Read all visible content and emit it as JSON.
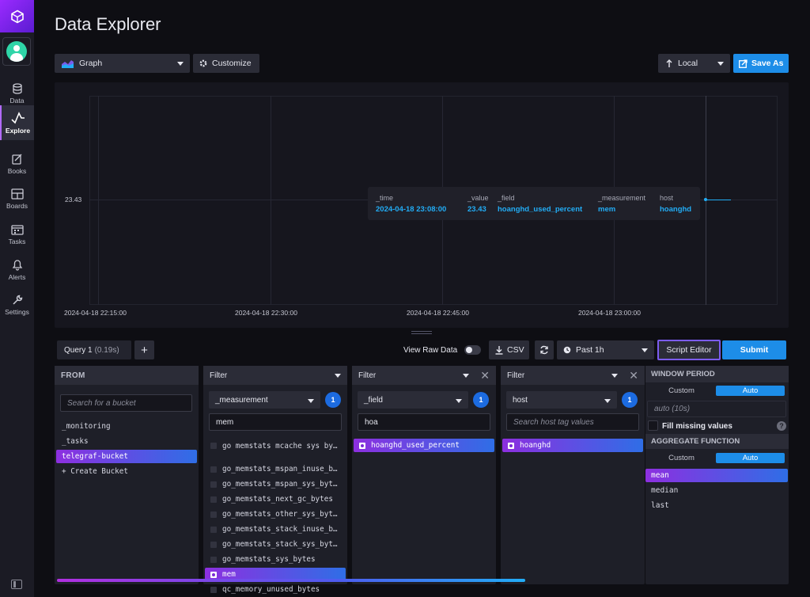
{
  "sidebar": {
    "items": [
      {
        "label": "Data",
        "icon": "database-icon"
      },
      {
        "label": "Explore",
        "icon": "graph-icon",
        "active": true
      },
      {
        "label": "Books",
        "icon": "notebook-icon"
      },
      {
        "label": "Boards",
        "icon": "dashboard-icon"
      },
      {
        "label": "Tasks",
        "icon": "calendar-icon"
      },
      {
        "label": "Alerts",
        "icon": "bell-icon"
      },
      {
        "label": "Settings",
        "icon": "wrench-icon"
      }
    ]
  },
  "header": {
    "title": "Data Explorer"
  },
  "toolbar": {
    "view_type": "Graph",
    "customize": "Customize",
    "timezone": "Local",
    "save_as": "Save As"
  },
  "graph": {
    "y_tick": "23.43",
    "x_ticks": [
      "2024-04-18 22:15:00",
      "2024-04-18 22:30:00",
      "2024-04-18 22:45:00",
      "2024-04-18 23:00:00"
    ],
    "tooltip": {
      "headers": [
        "_time",
        "_value",
        "_field",
        "_measurement",
        "host"
      ],
      "values": [
        "2024-04-18 23:08:00",
        "23.43",
        "hoanghd_used_percent",
        "mem",
        "hoanghd"
      ]
    }
  },
  "chart_data": {
    "type": "line",
    "x": [
      "2024-04-18 23:08:00"
    ],
    "series": [
      {
        "values": [
          23.43
        ]
      }
    ],
    "x_ticks": [
      "2024-04-18 22:15:00",
      "2024-04-18 22:30:00",
      "2024-04-18 22:45:00",
      "2024-04-18 23:00:00"
    ],
    "y_ticks": [
      "23.43"
    ],
    "grid": true
  },
  "query_bar": {
    "query_name": "Query 1",
    "query_time": "(0.19s)",
    "add": "+",
    "view_raw": "View Raw Data",
    "csv": "CSV",
    "time_range": "Past 1h",
    "script_editor": "Script Editor",
    "submit": "Submit"
  },
  "from": {
    "header": "FROM",
    "search_placeholder": "Search for a bucket",
    "buckets": [
      "_monitoring",
      "_tasks",
      "telegraf-bucket"
    ],
    "selected": "telegraf-bucket",
    "create": "+ Create Bucket"
  },
  "filter1": {
    "header": "Filter",
    "key": "_measurement",
    "count": "1",
    "search": "mem",
    "items": [
      "go_memstats_mcache_sys_by…",
      "go_memstats_mspan_inuse_b…",
      "go_memstats_mspan_sys_byt…",
      "go_memstats_next_gc_bytes",
      "go_memstats_other_sys_byt…",
      "go_memstats_stack_inuse_b…",
      "go_memstats_stack_sys_byt…",
      "go_memstats_sys_bytes",
      "mem",
      "qc_memory_unused_bytes"
    ],
    "selected": "mem"
  },
  "filter2": {
    "header": "Filter",
    "key": "_field",
    "count": "1",
    "search": "hoa",
    "items": [
      "hoanghd_used_percent"
    ]
  },
  "filter3": {
    "header": "Filter",
    "key": "host",
    "count": "1",
    "search_placeholder": "Search host tag values",
    "items": [
      "hoanghd"
    ]
  },
  "aggregate": {
    "window_period": "WINDOW PERIOD",
    "custom": "Custom",
    "auto": "Auto",
    "auto_value": "auto (10s)",
    "fill_missing": "Fill missing values",
    "help": "?",
    "aggregate_function": "AGGREGATE FUNCTION",
    "functions": [
      "mean",
      "median",
      "last"
    ],
    "selected": "mean"
  }
}
